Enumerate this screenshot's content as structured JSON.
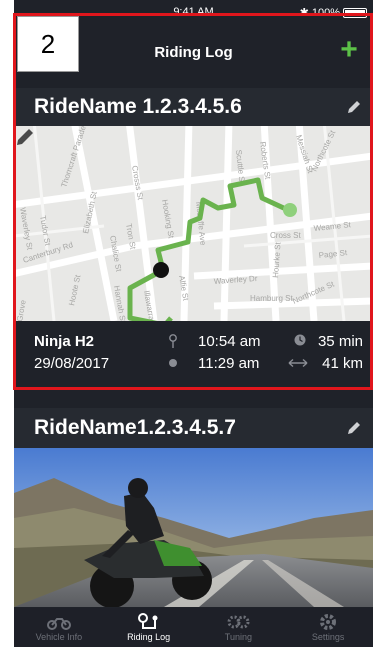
{
  "step_badge": "2",
  "status_bar": {
    "time": "9:41 AM",
    "battery": "100%"
  },
  "nav": {
    "title": "Riding Log",
    "add_label": "+"
  },
  "rides": [
    {
      "name": "RideName 1.2.3.4.5.6",
      "bike": "Ninja H2",
      "date": "29/08/2017",
      "start_time": "10:54 am",
      "end_time": "11:29 am",
      "duration": "35 min",
      "distance": "41 km",
      "map_streets": [
        "Thorncraft Parade",
        "Crosss St",
        "Canterbury Rd",
        "Tudor St",
        "Elizabeth St",
        "Waverley St",
        "Tron St",
        "Chalice St",
        "Hooking St",
        "Mozaffe Ave",
        "Scuttle St",
        "Roberts St",
        "Messiah St",
        "Northcote St",
        "Cross St",
        "Weame St",
        "Page St",
        "Waverley Dr",
        "Hourke St",
        "Northcote St",
        "Alfie St",
        "Hoote St",
        "Illawarra St",
        "Hannah St",
        "Hamburg St",
        "Grove"
      ]
    },
    {
      "name": "RideName1.2.3.4.5.7"
    }
  ],
  "tabs": [
    {
      "label": "Vehicle Info",
      "icon": "motorcycle-icon"
    },
    {
      "label": "Riding Log",
      "icon": "route-icon"
    },
    {
      "label": "Tuning",
      "icon": "gears-icon"
    },
    {
      "label": "Settings",
      "icon": "settings-icon"
    }
  ],
  "colors": {
    "accent": "#5cc148",
    "route": "#6ab34e",
    "highlight": "#e0161c",
    "background": "#1f2229"
  }
}
